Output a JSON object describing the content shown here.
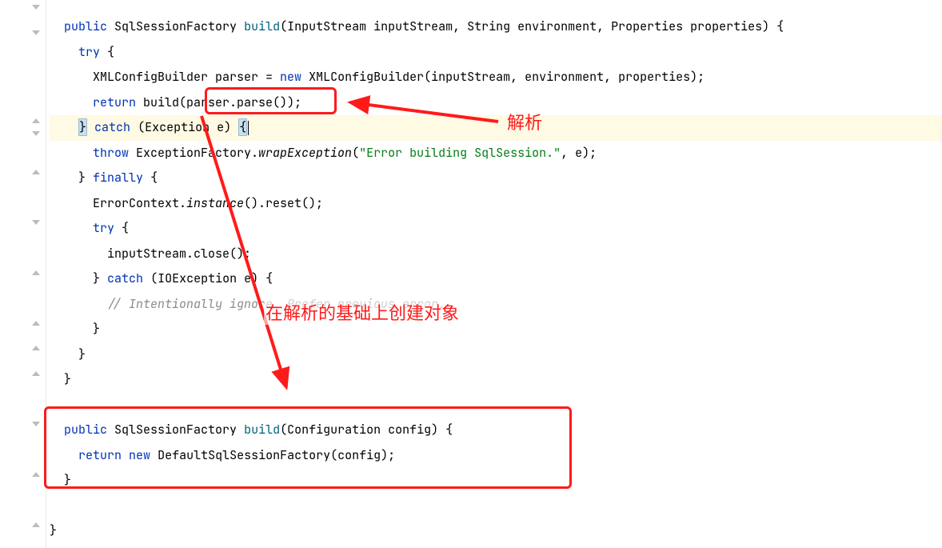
{
  "code": {
    "l1": {
      "kw_public": "public",
      "type": "SqlSessionFactory",
      "method": "build",
      "params": "(InputStream inputStream, String environment, Properties properties) {"
    },
    "l2": {
      "kw_try": "try",
      "brace": " {"
    },
    "l3": {
      "type": "XMLConfigBuilder",
      "ident": " parser = ",
      "kw_new": "new",
      "ctor": " XMLConfigBuilder(inputStream, environment, properties);"
    },
    "l4": {
      "kw_return": "return",
      "text": " build(",
      "call": "parser.parse()",
      "tail": ");"
    },
    "l5": {
      "close": "}",
      "kw_catch": "catch",
      "params": " (Exception e) ",
      "brace_open": "{"
    },
    "l6": {
      "kw_throw": "throw",
      "text1": " ExceptionFactory.",
      "wrap": "wrapException",
      "paren_open": "(",
      "str": "\"Error building SqlSession.\"",
      "tail": ", e);"
    },
    "l7": {
      "close": "}",
      "kw_finally": "finally",
      "brace": " {"
    },
    "l8": {
      "text": "ErrorContext.",
      "instance": "instance",
      "tail": "().reset();"
    },
    "l9": {
      "kw_try": "try",
      "brace": " {"
    },
    "l10": {
      "text": "inputStream.close();"
    },
    "l11": {
      "close": "}",
      "kw_catch": "catch",
      "params": " (IOException e) {"
    },
    "l12": {
      "comment": "// Intentionally ignore. Prefer previous error."
    },
    "l13": {
      "close": "}"
    },
    "l14": {
      "close": "}"
    },
    "l15": {
      "close": "}"
    },
    "l17": {
      "kw_public": "public",
      "type": "SqlSessionFactory",
      "method": "build",
      "params": "(Configuration config) {"
    },
    "l18": {
      "kw_return": "return",
      "kw_new": "new",
      "text": " DefaultSqlSessionFactory(config);"
    },
    "l19": {
      "close": "}"
    },
    "l21": {
      "close": "}"
    }
  },
  "annotations": {
    "label1": "解析",
    "label2": "在解析的基础上创建对象"
  },
  "colors": {
    "annotation_red": "#ff1a1a",
    "keyword_blue": "#0033b3",
    "method_teal": "#00627a",
    "string_green": "#067d17",
    "comment_gray": "#8c8c8c",
    "highlight_yellow": "#fffae3"
  }
}
